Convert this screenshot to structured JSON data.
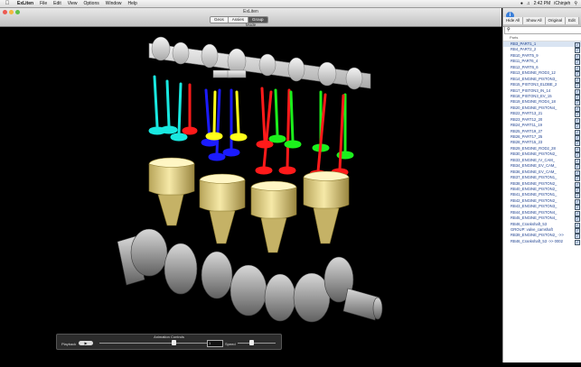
{
  "menubar": {
    "app_name": "ExLiten",
    "menus": [
      "File",
      "Edit",
      "View",
      "Options",
      "Window",
      "Help"
    ],
    "clock": "2:42 PM",
    "user": "iChinjeh"
  },
  "window": {
    "title": "ExLiten",
    "view_modes": [
      "Geos",
      "Assies",
      "Group"
    ],
    "active_mode": "Group",
    "mode_label": "Mode"
  },
  "sidebar": {
    "icon_label": "Show info",
    "buttons": [
      "Hide All",
      "Show All",
      "Original",
      "Edit"
    ],
    "search_placeholder": "",
    "column_header": "Parts",
    "items": [
      {
        "label": "RB3_PART1_1",
        "checked": true,
        "selected": true
      },
      {
        "label": "RB4_PART2_2",
        "checked": true
      },
      {
        "label": "RB10_PART5_9",
        "checked": true
      },
      {
        "label": "RB11_PART6_4",
        "checked": true
      },
      {
        "label": "RB12_PART6_6",
        "checked": true
      },
      {
        "label": "RB13_ENGINE_ROD3_12",
        "checked": true
      },
      {
        "label": "RB14_ENGINE_PISTON3_",
        "checked": true
      },
      {
        "label": "RB15_PISTON3_ELDBE_2",
        "checked": true
      },
      {
        "label": "RB17_PISTON3_IN_14",
        "checked": true
      },
      {
        "label": "RB18_PISTON3_EV_15",
        "checked": true
      },
      {
        "label": "RB19_ENGINE_ROD4_18",
        "checked": true
      },
      {
        "label": "RB20_ENGINE_PISTON4_",
        "checked": true
      },
      {
        "label": "RB22_PART13_21",
        "checked": true
      },
      {
        "label": "RB23_PART12_20",
        "checked": true
      },
      {
        "label": "RB24_PART11_19",
        "checked": true
      },
      {
        "label": "RB25_PART19_27",
        "checked": true
      },
      {
        "label": "RB26_PART17_25",
        "checked": true
      },
      {
        "label": "RB28_PART15_23",
        "checked": true
      },
      {
        "label": "RB29_ENGINE_ROD2_28",
        "checked": true
      },
      {
        "label": "RB30_ENGINE_PISTON2_",
        "checked": true
      },
      {
        "label": "RB33_ENGINE_IV_CAM_",
        "checked": true
      },
      {
        "label": "RB34_ENGINE_EV_CAM_",
        "checked": true
      },
      {
        "label": "RB36_ENGINE_EV_CAM_",
        "checked": true
      },
      {
        "label": "RB37_ENGINE_PISTON1_",
        "checked": true
      },
      {
        "label": "RB38_ENGINE_PISTON2_",
        "checked": true
      },
      {
        "label": "RB40_ENGINE_PISTON2_",
        "checked": true
      },
      {
        "label": "RB41_ENGINE_PISTON1_",
        "checked": true
      },
      {
        "label": "RB42_ENGINE_PISTON2_",
        "checked": true
      },
      {
        "label": "RB43_ENGINE_PISTON3_",
        "checked": true
      },
      {
        "label": "RB44_ENGINE_PISTON4_",
        "checked": true
      },
      {
        "label": "RB45_ENGINE_PISTON4_",
        "checked": true
      },
      {
        "label": "RB46_Crankshaft_53",
        "checked": true
      },
      {
        "label": "GROUP: valve_camshaft",
        "checked": true
      },
      {
        "label": "RB39_ENGINE_PISTON2_ ->>",
        "checked": true
      },
      {
        "label": "RB46_Crankshaft_53 ->> 0002",
        "checked": true
      }
    ]
  },
  "animation": {
    "title": "Animation Controls",
    "playback_label": "Playback",
    "play_symbol": "▶",
    "frame_value": "1",
    "speed_label": "Speed",
    "timeline_position": 0.68,
    "speed_position": 0.35
  }
}
